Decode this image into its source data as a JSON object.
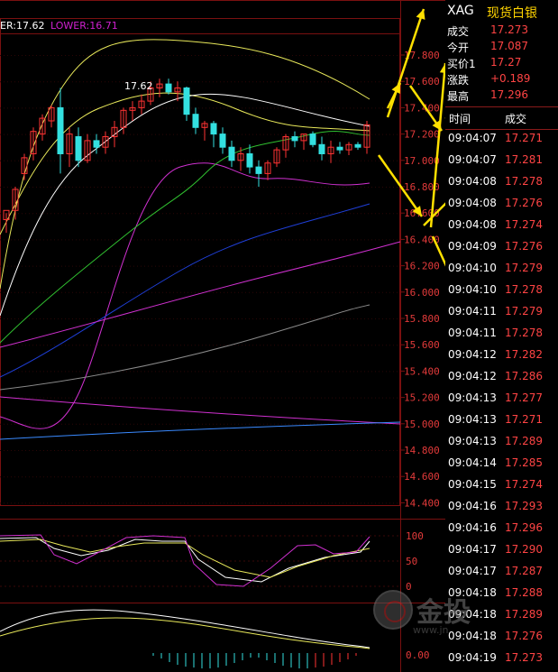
{
  "boll": {
    "upper_label": "ER:17.62",
    "lower_label": "LOWER:16.71",
    "upper_color": "#ffffff",
    "lower_color": "#d020d0"
  },
  "chart": {
    "high_label": "17.62",
    "price_axis": [
      "17.800",
      "17.600",
      "17.400",
      "17.200",
      "17.000",
      "16.800",
      "16.600",
      "16.400",
      "16.200",
      "16.000",
      "15.800",
      "15.600",
      "15.400",
      "15.200",
      "15.000",
      "14.800",
      "14.600",
      "14.400"
    ],
    "kdj_axis": [
      "100",
      "50",
      "0"
    ],
    "macd_axis": [
      "0.00"
    ],
    "colors": {
      "up": "#ff3333",
      "down": "#33e0e0",
      "grid": "#7a1010",
      "ma_white": "#ffffff",
      "ma_yellow": "#e8e85a",
      "ma_green": "#30c030",
      "ma_blue": "#1f3fd8",
      "ma_magenta": "#d030d0",
      "ma_gray": "#8a8a8a",
      "arrow": "#ffe000"
    }
  },
  "quote": {
    "symbol": "XAG",
    "name": "现货白银",
    "rows": [
      {
        "label": "成交",
        "value": "17.273"
      },
      {
        "label": "今开",
        "value": "17.087"
      },
      {
        "label": "买价1",
        "value": "17.27"
      },
      {
        "label": "涨跌",
        "value": "+0.189"
      },
      {
        "label": "最高",
        "value": "17.296"
      }
    ],
    "tick_header": {
      "time": "时间",
      "price": "成交"
    },
    "ticks": [
      {
        "time": "09:04:07",
        "price": "17.271"
      },
      {
        "time": "09:04:07",
        "price": "17.281"
      },
      {
        "time": "09:04:08",
        "price": "17.278"
      },
      {
        "time": "09:04:08",
        "price": "17.276"
      },
      {
        "time": "09:04:08",
        "price": "17.274"
      },
      {
        "time": "09:04:09",
        "price": "17.276"
      },
      {
        "time": "09:04:10",
        "price": "17.279"
      },
      {
        "time": "09:04:10",
        "price": "17.278"
      },
      {
        "time": "09:04:11",
        "price": "17.279"
      },
      {
        "time": "09:04:11",
        "price": "17.278"
      },
      {
        "time": "09:04:12",
        "price": "17.282"
      },
      {
        "time": "09:04:12",
        "price": "17.286"
      },
      {
        "time": "09:04:13",
        "price": "17.277"
      },
      {
        "time": "09:04:13",
        "price": "17.271"
      },
      {
        "time": "09:04:13",
        "price": "17.289"
      },
      {
        "time": "09:04:14",
        "price": "17.285"
      },
      {
        "time": "09:04:15",
        "price": "17.274"
      },
      {
        "time": "09:04:16",
        "price": "17.293"
      },
      {
        "time": "09:04:16",
        "price": "17.296"
      },
      {
        "time": "09:04:17",
        "price": "17.290"
      },
      {
        "time": "09:04:17",
        "price": "17.287"
      },
      {
        "time": "09:04:18",
        "price": "17.288"
      },
      {
        "time": "09:04:18",
        "price": "17.289"
      },
      {
        "time": "09:04:18",
        "price": "17.276"
      },
      {
        "time": "09:04:19",
        "price": "17.273"
      }
    ]
  },
  "watermark": {
    "word": "金投",
    "url": "www.jn"
  }
}
